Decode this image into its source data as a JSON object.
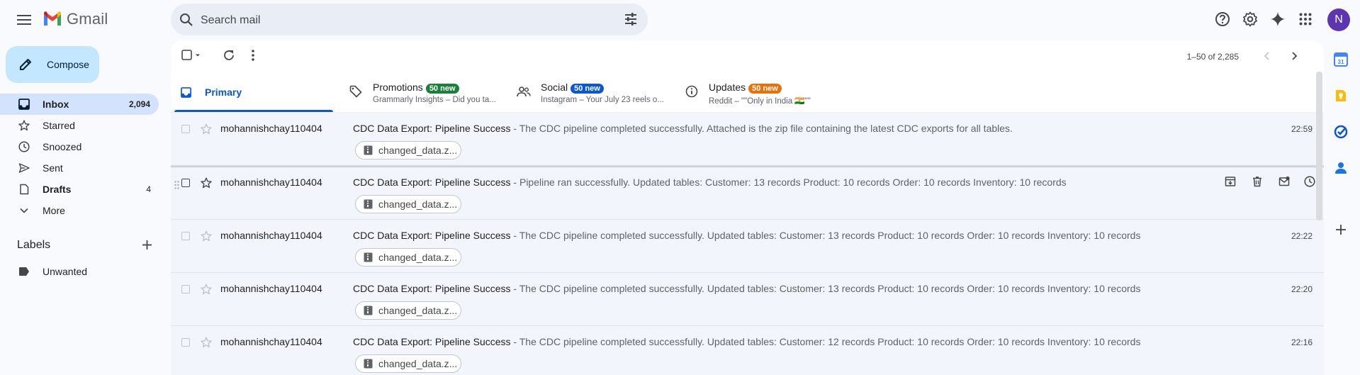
{
  "app": {
    "name": "Gmail"
  },
  "search": {
    "placeholder": "Search mail"
  },
  "user": {
    "initial": "N"
  },
  "compose": {
    "label": "Compose"
  },
  "sidebar": {
    "items": [
      {
        "label": "Inbox",
        "count": "2,094",
        "icon": "inbox-icon"
      },
      {
        "label": "Starred",
        "count": "",
        "icon": "star-icon"
      },
      {
        "label": "Snoozed",
        "count": "",
        "icon": "clock-icon"
      },
      {
        "label": "Sent",
        "count": "",
        "icon": "send-icon"
      },
      {
        "label": "Drafts",
        "count": "4",
        "icon": "draft-icon"
      },
      {
        "label": "More",
        "count": "",
        "icon": "chevron-down-icon"
      }
    ],
    "labels_heading": "Labels",
    "labels": [
      {
        "label": "Unwanted"
      }
    ]
  },
  "toolbar": {
    "pager": "1–50 of 2,285"
  },
  "tabs": [
    {
      "label": "Primary",
      "badge": "",
      "sub": ""
    },
    {
      "label": "Promotions",
      "badge": "50 new",
      "sub": "Grammarly Insights – Did you ta...",
      "badge_color": "#188038"
    },
    {
      "label": "Social",
      "badge": "50 new",
      "sub": "Instagram – Your July 23 reels o...",
      "badge_color": "#0b57d0"
    },
    {
      "label": "Updates",
      "badge": "50 new",
      "sub": "Reddit – \"\"Only in India 🇮🇳\"\"",
      "badge_color": "#e8710a"
    }
  ],
  "emails": [
    {
      "sender": "mohannishchay110404",
      "subject": "CDC Data Export: Pipeline Success",
      "snippet": " - The CDC pipeline completed successfully. Attached is the zip file containing the latest CDC exports for all tables.",
      "time": "22:59",
      "attachment": "changed_data.z..."
    },
    {
      "sender": "mohannishchay110404",
      "subject": "CDC Data Export: Pipeline Success",
      "snippet": " - Pipeline ran successfully. Updated tables: Customer: 13 records Product: 10 records Order: 10 records Inventory: 10 records",
      "time": "",
      "attachment": "changed_data.z..."
    },
    {
      "sender": "mohannishchay110404",
      "subject": "CDC Data Export: Pipeline Success",
      "snippet": " - The CDC pipeline completed successfully. Updated tables: Customer: 13 records Product: 10 records Order: 10 records Inventory: 10 records",
      "time": "22:22",
      "attachment": "changed_data.z..."
    },
    {
      "sender": "mohannishchay110404",
      "subject": "CDC Data Export: Pipeline Success",
      "snippet": " - The CDC pipeline completed successfully. Updated tables: Customer: 13 records Product: 10 records Order: 10 records Inventory: 10 records",
      "time": "22:20",
      "attachment": "changed_data.z..."
    },
    {
      "sender": "mohannishchay110404",
      "subject": "CDC Data Export: Pipeline Success",
      "snippet": " - The CDC pipeline completed successfully. Updated tables: Customer: 12 records Product: 10 records Order: 10 records Inventory: 10 records",
      "time": "22:16",
      "attachment": "changed_data.z..."
    }
  ]
}
